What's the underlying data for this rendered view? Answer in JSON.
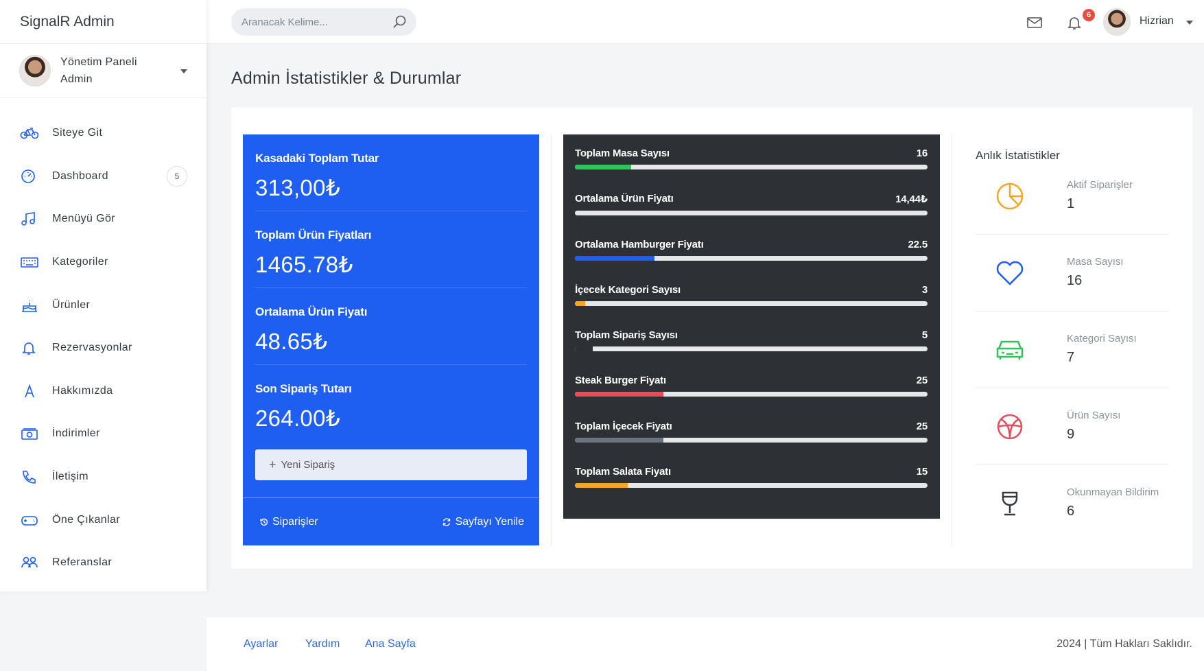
{
  "brand": "SignalR Admin",
  "profile": {
    "line1": "Yönetim Paneli",
    "line2": "Admin"
  },
  "sidebar": {
    "items": [
      {
        "label": "Siteye Git",
        "icon": "bicycle-icon"
      },
      {
        "label": "Dashboard",
        "icon": "dashboard-icon",
        "badge": "5"
      },
      {
        "label": "Menüyü Gör",
        "icon": "music-note-icon"
      },
      {
        "label": "Kategoriler",
        "icon": "keyboard-icon"
      },
      {
        "label": "Ürünler",
        "icon": "cake-icon"
      },
      {
        "label": "Rezervasyonlar",
        "icon": "bell-icon"
      },
      {
        "label": "Hakkımızda",
        "icon": "letter-a-icon"
      },
      {
        "label": "İndirimler",
        "icon": "money-icon"
      },
      {
        "label": "İletişim",
        "icon": "phone-icon"
      },
      {
        "label": "Öne Çıkanlar",
        "icon": "gamepad-icon"
      },
      {
        "label": "Referanslar",
        "icon": "users-icon"
      }
    ]
  },
  "topbar": {
    "search_placeholder": "Aranacak Kelime...",
    "notification_count": "6",
    "user_name": "Hizrian"
  },
  "page": {
    "title": "Admin İstatistikler & Durumlar"
  },
  "blue_card": {
    "stats": [
      {
        "label": "Kasadaki Toplam Tutar",
        "value": "313,00₺"
      },
      {
        "label": "Toplam Ürün Fiyatları",
        "value": "1465.78₺"
      },
      {
        "label": "Ortalama Ürün Fiyatı",
        "value": "48.65₺"
      },
      {
        "label": "Son Sipariş Tutarı",
        "value": "264.00₺"
      }
    ],
    "new_order_label": "Yeni Sipariş",
    "orders_link": "Siparişler",
    "refresh_link": "Sayfayı Yenile"
  },
  "progress": [
    {
      "label": "Toplam Masa Sayısı",
      "value": "16",
      "fill": 0.16,
      "color": "#2ec45c"
    },
    {
      "label": "Ortalama Ürün Fiyatı",
      "value": "14,44₺",
      "fill": 0.0,
      "color": "#ffffff"
    },
    {
      "label": "Ortalama Hamburger Fiyatı",
      "value": "22.5",
      "fill": 0.225,
      "color": "#1e5ef0"
    },
    {
      "label": "İçecek Kategori Sayısı",
      "value": "3",
      "fill": 0.03,
      "color": "#f5a623"
    },
    {
      "label": "Toplam Sipariş Sayısı",
      "value": "5",
      "fill": 0.05,
      "color": "#2d3034"
    },
    {
      "label": "Steak Burger Fiyatı",
      "value": "25",
      "fill": 0.25,
      "color": "#e74c5a"
    },
    {
      "label": "Toplam İçecek Fiyatı",
      "value": "25",
      "fill": 0.25,
      "color": "#6c757d"
    },
    {
      "label": "Toplam Salata Fiyatı",
      "value": "15",
      "fill": 0.15,
      "color": "#f5a623"
    }
  ],
  "right_stats": {
    "title": "Anlık İstatistikler",
    "items": [
      {
        "label": "Aktif Siparişler",
        "value": "1",
        "icon": "pie-chart-icon",
        "color": "#f5a623"
      },
      {
        "label": "Masa Sayısı",
        "value": "16",
        "icon": "heart-icon",
        "color": "#1e5ef0"
      },
      {
        "label": "Kategori Sayısı",
        "value": "7",
        "icon": "car-icon",
        "color": "#2ec45c"
      },
      {
        "label": "Ürün Sayısı",
        "value": "9",
        "icon": "basketball-icon",
        "color": "#e74c5a"
      },
      {
        "label": "Okunmayan Bildirim",
        "value": "6",
        "icon": "glass-icon",
        "color": "#343a40"
      }
    ]
  },
  "footer": {
    "links": [
      "Ayarlar",
      "Yardım",
      "Ana Sayfa"
    ],
    "copyright": "2024 | Tüm Hakları Saklıdır."
  }
}
